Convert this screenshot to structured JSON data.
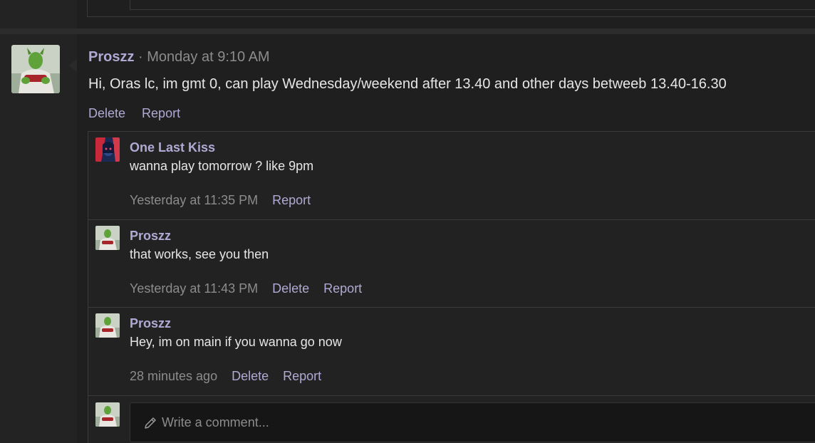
{
  "post": {
    "author": "Proszz",
    "separator": "·",
    "time": "Monday at 9:10 AM",
    "body": "Hi, Oras lc, im gmt 0, can play Wednesday/weekend after 13.40 and other days betweeb 13.40-16.30",
    "actions": {
      "delete": "Delete",
      "report": "Report"
    }
  },
  "comments": [
    {
      "author": "One Last Kiss",
      "text": "wanna play tomorrow ? like 9pm",
      "time": "Yesterday at 11:35 PM",
      "report": "Report"
    },
    {
      "author": "Proszz",
      "text": "that works, see you then",
      "time": "Yesterday at 11:43 PM",
      "delete": "Delete",
      "report": "Report"
    },
    {
      "author": "Proszz",
      "text": "Hey, im on main if you wanna go now",
      "time": "28 minutes ago",
      "delete": "Delete",
      "report": "Report"
    }
  ],
  "composer": {
    "placeholder": "Write a comment...",
    "icon": "pencil-icon"
  },
  "colors": {
    "accent": "#b1a9d3",
    "muted": "#8c8c8c",
    "text": "#e6e6e6",
    "background": "#1e1e1e",
    "border": "#3a3a3a"
  }
}
